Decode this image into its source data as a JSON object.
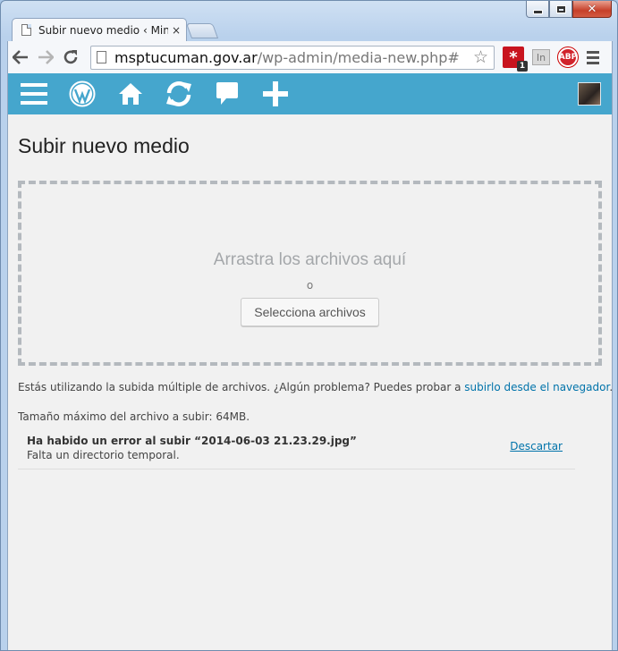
{
  "browser": {
    "tab_title": "Subir nuevo medio ‹ Minis",
    "tab_close": "×",
    "url_host": "msptucuman.gov.ar",
    "url_path": "/wp-admin/media-new.php#",
    "extensions": [
      {
        "name": "lastpass",
        "label": "*",
        "badge": "1"
      },
      {
        "name": "inactive",
        "label": "In"
      },
      {
        "name": "adblock-plus",
        "label": "ABP"
      }
    ]
  },
  "icons": {
    "back": "arrow-left-icon",
    "forward": "arrow-right-icon",
    "reload": "reload-icon",
    "star": "star-icon",
    "menu": "hamburger-icon"
  },
  "adminbar": {
    "color": "#45a6cd",
    "icons": [
      "menu-icon",
      "wordpress-icon",
      "home-icon",
      "updates-icon",
      "comments-icon",
      "add-new-icon"
    ]
  },
  "page": {
    "title": "Subir nuevo medio",
    "drop_info": "Arrastra los archivos aquí",
    "or": "o",
    "select_button": "Selecciona archivos",
    "info_text": "Estás utilizando la subida múltiple de archivos. ¿Algún problema? Puedes probar a ",
    "info_link": "subirlo desde el navegador",
    "info_end": ".",
    "max_size": "Tamaño máximo del archivo a subir: 64MB.",
    "error": {
      "title": "Ha habido un error al subir “2014-06-03 21.23.29.jpg”",
      "message": "Falta un directorio temporal.",
      "dismiss": "Descartar"
    }
  }
}
